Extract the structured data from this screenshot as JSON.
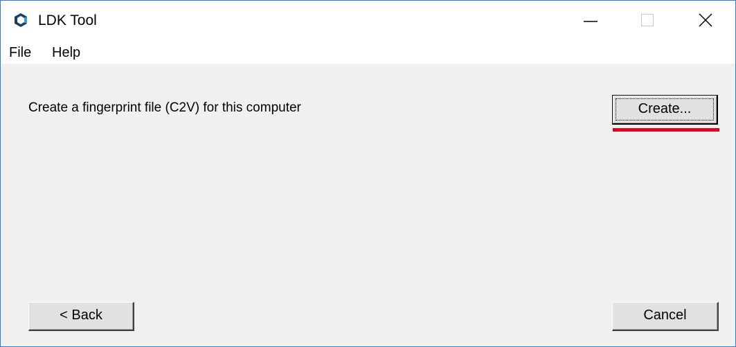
{
  "window": {
    "title": "LDK Tool",
    "icon": "ldk-logo-icon",
    "controls": {
      "minimize_icon": "minimize-icon",
      "maximize_icon": "maximize-icon",
      "close_icon": "close-icon"
    }
  },
  "menu": {
    "items": [
      {
        "label": "File"
      },
      {
        "label": "Help"
      }
    ]
  },
  "main": {
    "prompt": "Create a fingerprint file (C2V) for this computer",
    "create_label": "Create...",
    "highlight_color": "#e0001b"
  },
  "footer": {
    "back_label": "< Back",
    "cancel_label": "Cancel"
  }
}
